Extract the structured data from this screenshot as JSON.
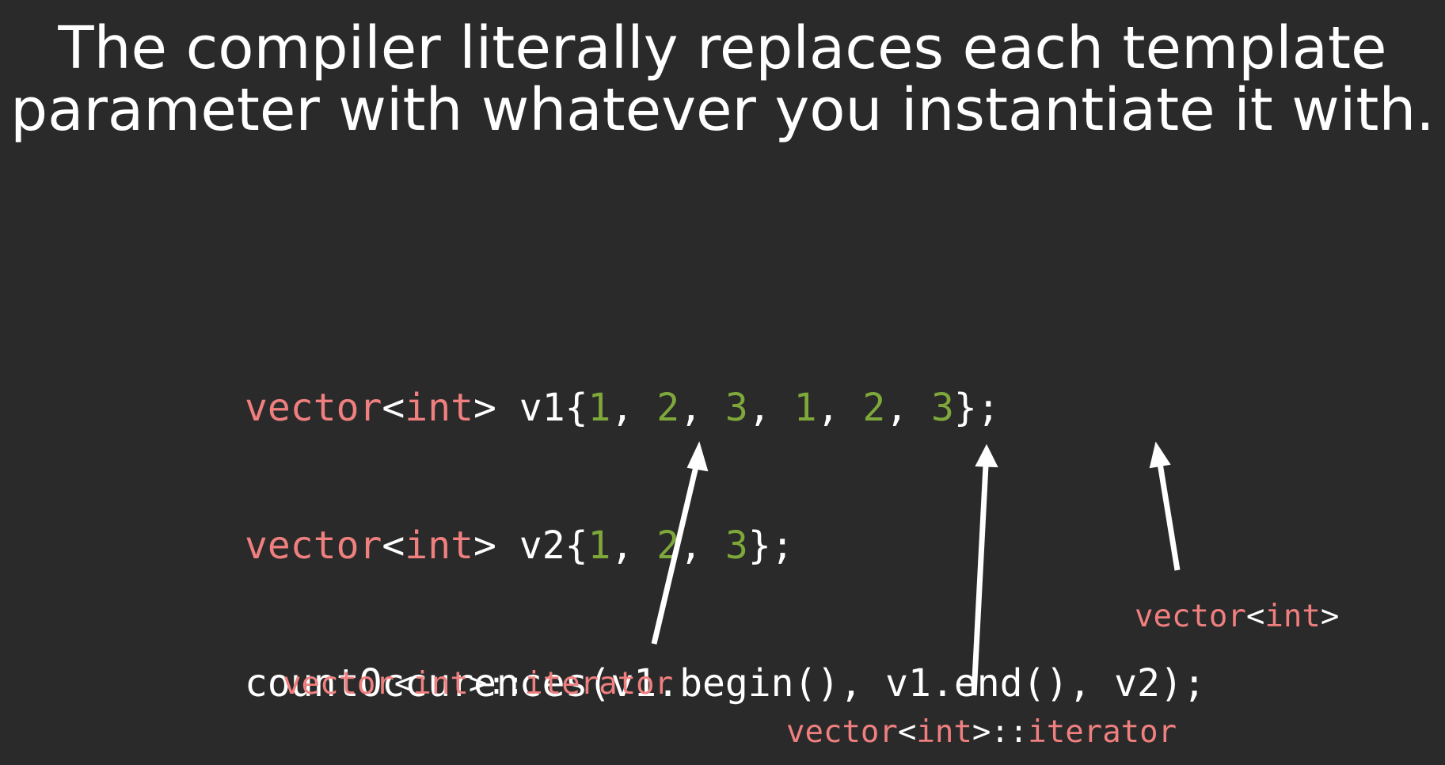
{
  "title": {
    "line1": "The compiler literally replaces each template",
    "line2": "parameter with whatever you instantiate it with."
  },
  "code": {
    "line1": [
      {
        "t": "vector",
        "c": "kw"
      },
      {
        "t": "<",
        "c": "plain"
      },
      {
        "t": "int",
        "c": "kw"
      },
      {
        "t": "> v1{",
        "c": "plain"
      },
      {
        "t": "1",
        "c": "num"
      },
      {
        "t": ", ",
        "c": "plain"
      },
      {
        "t": "2",
        "c": "num"
      },
      {
        "t": ", ",
        "c": "plain"
      },
      {
        "t": "3",
        "c": "num"
      },
      {
        "t": ", ",
        "c": "plain"
      },
      {
        "t": "1",
        "c": "num"
      },
      {
        "t": ", ",
        "c": "plain"
      },
      {
        "t": "2",
        "c": "num"
      },
      {
        "t": ", ",
        "c": "plain"
      },
      {
        "t": "3",
        "c": "num"
      },
      {
        "t": "};",
        "c": "plain"
      }
    ],
    "line2": [
      {
        "t": "vector",
        "c": "kw"
      },
      {
        "t": "<",
        "c": "plain"
      },
      {
        "t": "int",
        "c": "kw"
      },
      {
        "t": "> v2{",
        "c": "plain"
      },
      {
        "t": "1",
        "c": "num"
      },
      {
        "t": ", ",
        "c": "plain"
      },
      {
        "t": "2",
        "c": "num"
      },
      {
        "t": ", ",
        "c": "plain"
      },
      {
        "t": "3",
        "c": "num"
      },
      {
        "t": "};",
        "c": "plain"
      }
    ],
    "line3": [
      {
        "t": "countOccurences(v1.begin(), v1.end(), v2);",
        "c": "plain"
      }
    ]
  },
  "labels": {
    "begin": [
      {
        "t": "vector",
        "c": "kw"
      },
      {
        "t": "<",
        "c": "plain"
      },
      {
        "t": "int",
        "c": "kw"
      },
      {
        "t": ">::",
        "c": "plain"
      },
      {
        "t": "iterator",
        "c": "kw"
      }
    ],
    "end": [
      {
        "t": "vector",
        "c": "kw"
      },
      {
        "t": "<",
        "c": "plain"
      },
      {
        "t": "int",
        "c": "kw"
      },
      {
        "t": ">::",
        "c": "plain"
      },
      {
        "t": "iterator",
        "c": "kw"
      }
    ],
    "v2": [
      {
        "t": "vector",
        "c": "kw"
      },
      {
        "t": "<",
        "c": "plain"
      },
      {
        "t": "int",
        "c": "kw"
      },
      {
        "t": ">",
        "c": "plain"
      }
    ]
  },
  "colors": {
    "background": "#2a2a2a",
    "keyword": "#f07f7f",
    "number": "#7ea83a",
    "text": "#ffffff"
  }
}
